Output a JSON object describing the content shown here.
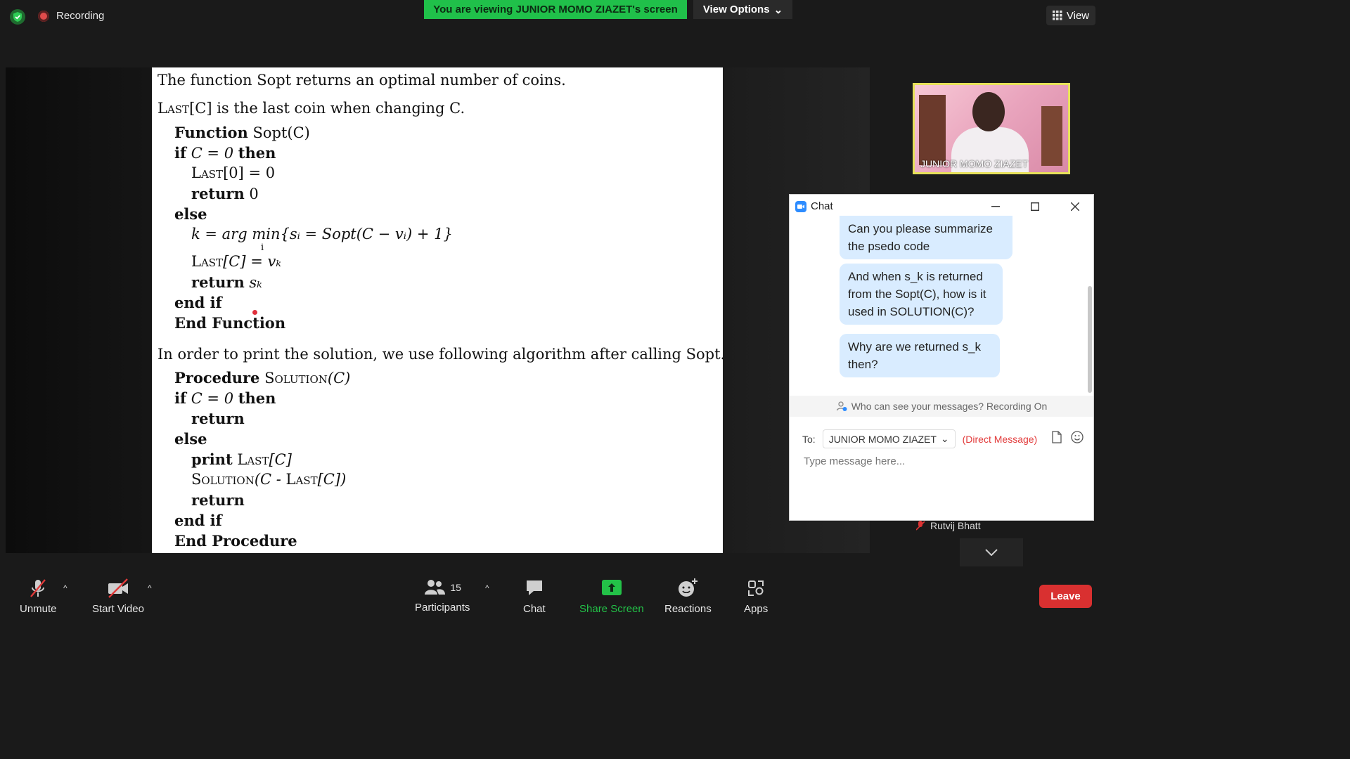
{
  "topbar": {
    "recording_label": "Recording",
    "viewing_banner": "You are viewing JUNIOR MOMO ZIAZET's screen",
    "view_options_label": "View Options",
    "view_label": "View"
  },
  "slide": {
    "line1": "The function Sopt returns an optimal number of coins.",
    "line2_sc": "Last",
    "line2_rest": "[C] is the last coin when changing C.",
    "func_kw": "Function",
    "func_name": " Sopt(C)",
    "if_kw": "if",
    "if_cond": " C = 0 ",
    "then_kw": "then",
    "last0_sc": "Last",
    "last0_rest": "[0] = 0",
    "return_kw": "return",
    "return0_val": "  0",
    "else_kw": "else",
    "argmin_line": "k = arg min{sᵢ = Sopt(C − vᵢ) + 1}",
    "argmin_sub": "i",
    "lastc_sc": "Last",
    "lastc_rest": "[C] = vₖ",
    "return_sk_val": "  sₖ",
    "endif_kw": "end if",
    "end_function_kw": "End Function",
    "para2": "In order to print the solution, we use following algorithm after calling Sopt.",
    "proc_kw": "Procedure",
    "proc_name_sc": " Solution",
    "proc_name_rest": "(C)",
    "print_kw": "print",
    "print_sc": "  Last",
    "print_rest": "[C]",
    "sol_call_sc": "Solution",
    "sol_call_mid": "(C - ",
    "sol_call_sc2": "Last",
    "sol_call_end": "[C])",
    "end_procedure_kw": "End Procedure"
  },
  "video": {
    "participant_name": "JUNIOR MOMO ZIAZET"
  },
  "gallery": {
    "next_participant": "Rutvij Bhatt"
  },
  "chat": {
    "title": "Chat",
    "messages": [
      "Can you please summarize the psedo code",
      "And when s_k is returned from the Sopt(C), how is it used in SOLUTION(C)?",
      "Why are we returned s_k then?"
    ],
    "visibility_notice": "Who can see your messages? Recording On",
    "to_label": "To:",
    "recipient": "JUNIOR MOMO ZIAZET",
    "direct_message": "(Direct Message)",
    "input_placeholder": "Type message here..."
  },
  "toolbar": {
    "unmute": "Unmute",
    "start_video": "Start Video",
    "participants_count": "15",
    "participants": "Participants",
    "chat": "Chat",
    "share_screen": "Share Screen",
    "reactions": "Reactions",
    "apps": "Apps",
    "leave": "Leave"
  },
  "colors": {
    "banner_green": "#20c04a",
    "share_green": "#23c248",
    "leave_red": "#d93030",
    "bubble_blue": "#d9ecff",
    "dm_red": "#e23b3b",
    "video_border": "#e6e05a"
  }
}
